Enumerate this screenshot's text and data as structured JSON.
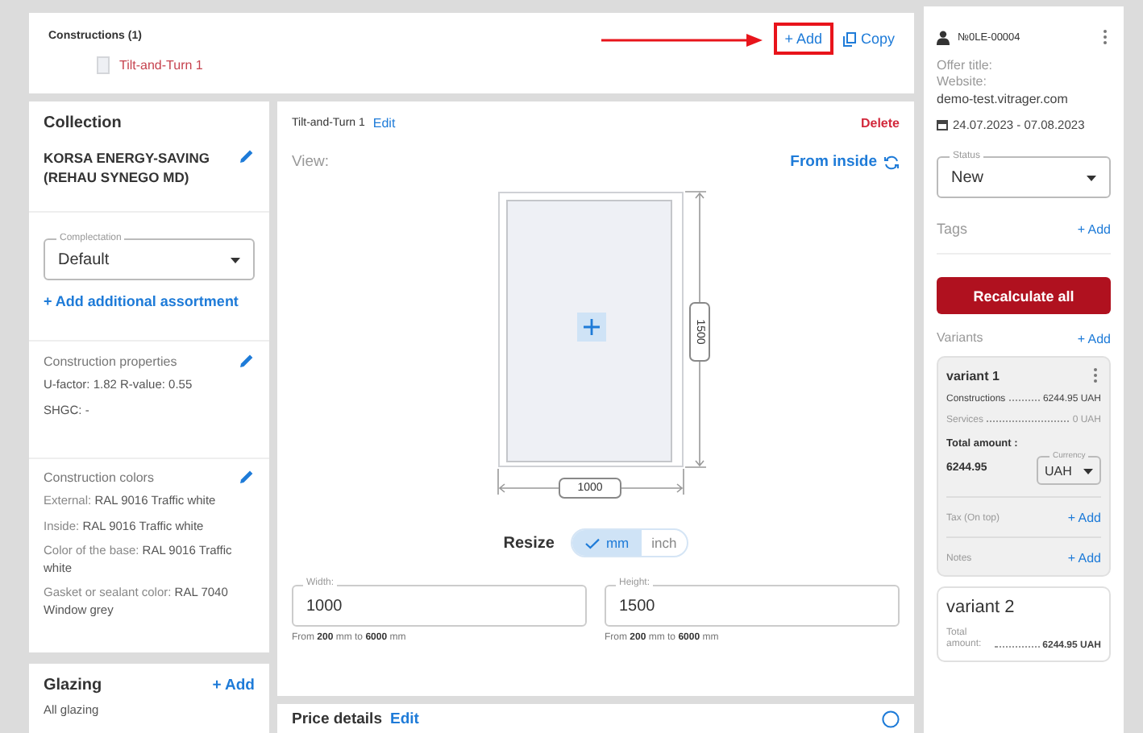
{
  "constructions": {
    "title": "Constructions (1)",
    "items": [
      {
        "label": "Tilt-and-Turn 1",
        "selected": true
      }
    ],
    "add_button": {
      "label": "+ Add",
      "highlighted": true
    },
    "copy_button": "Copy"
  },
  "collection": {
    "title": "Collection",
    "name": "KORSA ENERGY-SAVING (REHAU SYNEGO MD)",
    "complectation": {
      "label": "Complectation",
      "value": "Default"
    },
    "add_assortment": "+ Add additional assortment",
    "properties": {
      "title": "Construction properties",
      "lines": [
        "U-factor: 1.82  R-value: 0.55",
        "SHGC: -"
      ]
    },
    "colors": {
      "title": "Construction colors",
      "lines": [
        {
          "label": "External:",
          "value": "RAL 9016 Traffic white"
        },
        {
          "label": "Inside:",
          "value": "RAL 9016 Traffic white"
        },
        {
          "label": "Color of the base:",
          "value": "RAL 9016 Traffic white"
        },
        {
          "label": "Gasket or sealant color:",
          "value": "RAL 7040 Window grey"
        }
      ]
    }
  },
  "glazing": {
    "title": "Glazing",
    "add": "+ Add",
    "subtitle": "All glazing"
  },
  "construction": {
    "name": "Tilt-and-Turn 1",
    "edit": "Edit",
    "delete": "Delete",
    "view_label": "View:",
    "view_value": "From inside",
    "width_dim": "1000",
    "height_dim": "1500",
    "resize_label": "Resize",
    "units": [
      {
        "label": "mm",
        "selected": true
      },
      {
        "label": "inch",
        "selected": false
      }
    ],
    "fields": [
      {
        "label": "Width:",
        "value": "1000",
        "hint": "From **200** mm to **6000** mm"
      },
      {
        "label": "Height:",
        "value": "1500",
        "hint": "From **200** mm to **6000** mm"
      }
    ]
  },
  "price_details": {
    "title": "Price details",
    "edit": "Edit"
  },
  "offer": {
    "number": "№0LE-00004",
    "offer_title": "Offer title:",
    "website_label": "Website:",
    "website": "demo-test.vitrager.com",
    "dates": "24.07.2023 - 07.08.2023",
    "status": {
      "label": "Status",
      "value": "New"
    },
    "tags": "Tags",
    "tags_add": "+ Add",
    "recalculate": "Recalculate all",
    "variants_title": "Variants",
    "variants_add": "+ Add",
    "variants": [
      {
        "name": "variant 1",
        "selected": true,
        "kind": "detailed",
        "lines": [
          {
            "label": "Constructions",
            "value": "6244.95 UAH"
          },
          {
            "label": "Services",
            "value": "0 UAH"
          }
        ],
        "total_label": "Total amount :",
        "total": "6244.95",
        "currency": {
          "label": "Currency",
          "value": "UAH"
        },
        "extras": [
          {
            "label": "Tax (On top)",
            "add": "+ Add"
          },
          {
            "label": "Notes",
            "add": "+ Add"
          }
        ]
      },
      {
        "name": "variant 2",
        "selected": false,
        "kind": "summary",
        "total_label": "Total amount:",
        "total": "6244.95 UAH"
      }
    ]
  }
}
